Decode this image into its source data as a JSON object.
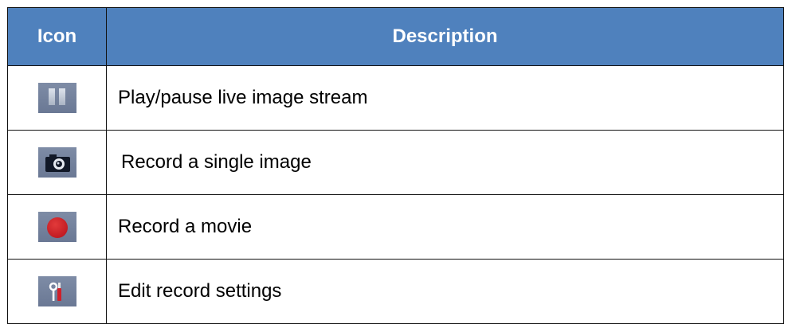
{
  "table": {
    "headers": {
      "icon": "Icon",
      "description": "Description"
    },
    "rows": [
      {
        "icon": "pause-icon",
        "description": "Play/pause live image stream"
      },
      {
        "icon": "camera-icon",
        "description": "Record a single image"
      },
      {
        "icon": "record-icon",
        "description": "Record a movie"
      },
      {
        "icon": "settings-tools-icon",
        "description": "Edit record settings"
      }
    ]
  },
  "colors": {
    "header_bg": "#4f81bd",
    "header_text": "#ffffff",
    "icon_bg": "#7482a0",
    "record_red": "#d0202a"
  }
}
